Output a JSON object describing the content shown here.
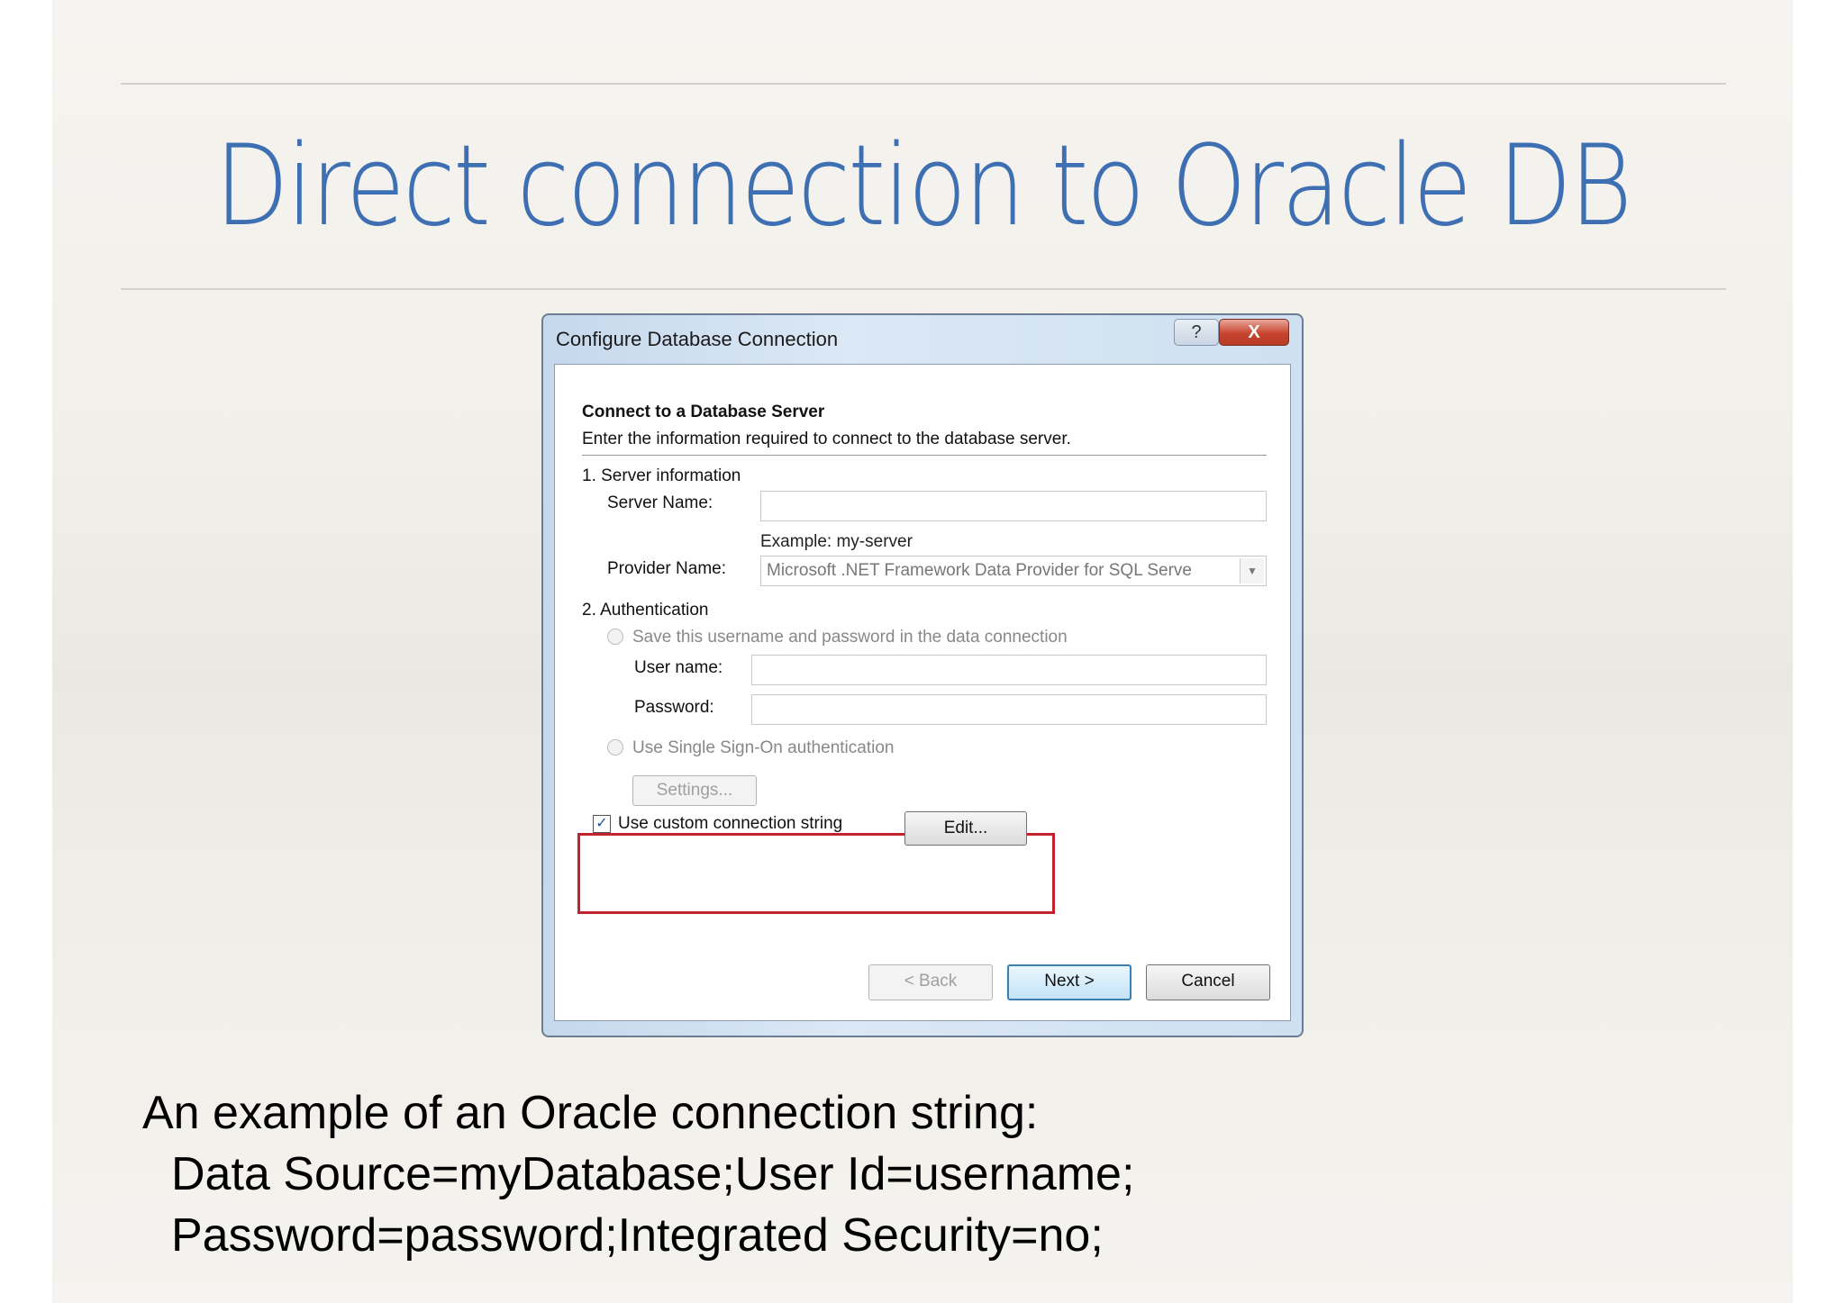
{
  "slide": {
    "title": "Direct connection to Oracle DB"
  },
  "dialog": {
    "window_title": "Configure Database Connection",
    "help_label": "?",
    "close_label": "X",
    "heading": "Connect to a Database Server",
    "subheading": "Enter the information required to connect to the database server.",
    "section1": "1. Server information",
    "server_name_label": "Server Name:",
    "server_name_value": "",
    "server_example": "Example: my-server",
    "provider_label": "Provider Name:",
    "provider_value": "Microsoft .NET Framework Data Provider for SQL Serve",
    "section2": "2. Authentication",
    "save_credentials_label": "Save this username and password in the data connection",
    "user_name_label": "User name:",
    "user_name_value": "",
    "password_label": "Password:",
    "password_value": "",
    "sso_label": "Use Single Sign-On authentication",
    "settings_label": "Settings...",
    "custom_string_label": "Use custom connection string",
    "custom_string_checked": true,
    "edit_label": "Edit...",
    "back_label": "< Back",
    "next_label": "Next >",
    "cancel_label": "Cancel",
    "highlight_color": "#c0232b"
  },
  "caption": {
    "line1": "An example of an Oracle connection string:",
    "line2": "Data Source=myDatabase;User Id=username;",
    "line3": "Password=password;Integrated Security=no;"
  },
  "colors": {
    "title": "#3f6fb3",
    "accent_button": "#3c7fb1"
  }
}
